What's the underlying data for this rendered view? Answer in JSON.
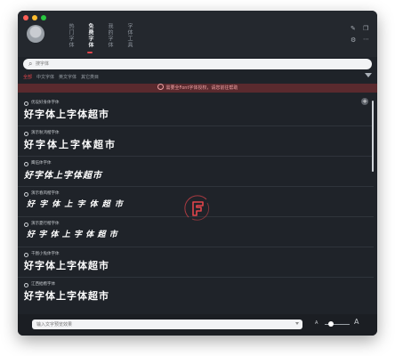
{
  "window": {
    "traffic_colors": [
      "#ff5f57",
      "#febc2e",
      "#28c840"
    ]
  },
  "header": {
    "tabs": [
      {
        "label": "热门字体",
        "active": false
      },
      {
        "label": "免费字体",
        "active": true
      },
      {
        "label": "我的字体",
        "active": false
      },
      {
        "label": "字体工具",
        "active": false
      }
    ],
    "icons": [
      "edit-icon",
      "copy-icon",
      "gear-icon",
      "more-icon"
    ]
  },
  "search": {
    "placeholder": "搜字体"
  },
  "filters": {
    "items": [
      {
        "label": "全部",
        "active": true
      },
      {
        "label": "中文字体",
        "active": false
      },
      {
        "label": "英文字体",
        "active": false
      },
      {
        "label": "其它类目",
        "active": false
      }
    ]
  },
  "banner": {
    "text": "需要全Font字体授权，请您前往帮助"
  },
  "fonts": [
    {
      "name": "优设好身体字体",
      "preview": "好字体上字体超市"
    },
    {
      "name": "演示秋鸿楷字体",
      "preview": "好字体上字体超市"
    },
    {
      "name": "鹰伍体字体",
      "preview": "好字体上字体超市"
    },
    {
      "name": "演示春风楷字体",
      "preview": "好 字 体 上 字 体 超 市"
    },
    {
      "name": "演示夏行楷字体",
      "preview": "好 字 体 上 字 体 超 市"
    },
    {
      "name": "千图小兔体字体",
      "preview": "好字体上字体超市"
    },
    {
      "name": "江西拙楷字体",
      "preview": "好字体上字体超市"
    }
  ],
  "footer": {
    "preview_placeholder": "输入文字预览效果",
    "size_small": "A",
    "size_large": "A",
    "size_level": 0.25
  },
  "colors": {
    "accent": "#e2454b",
    "background": "#1f2329"
  }
}
